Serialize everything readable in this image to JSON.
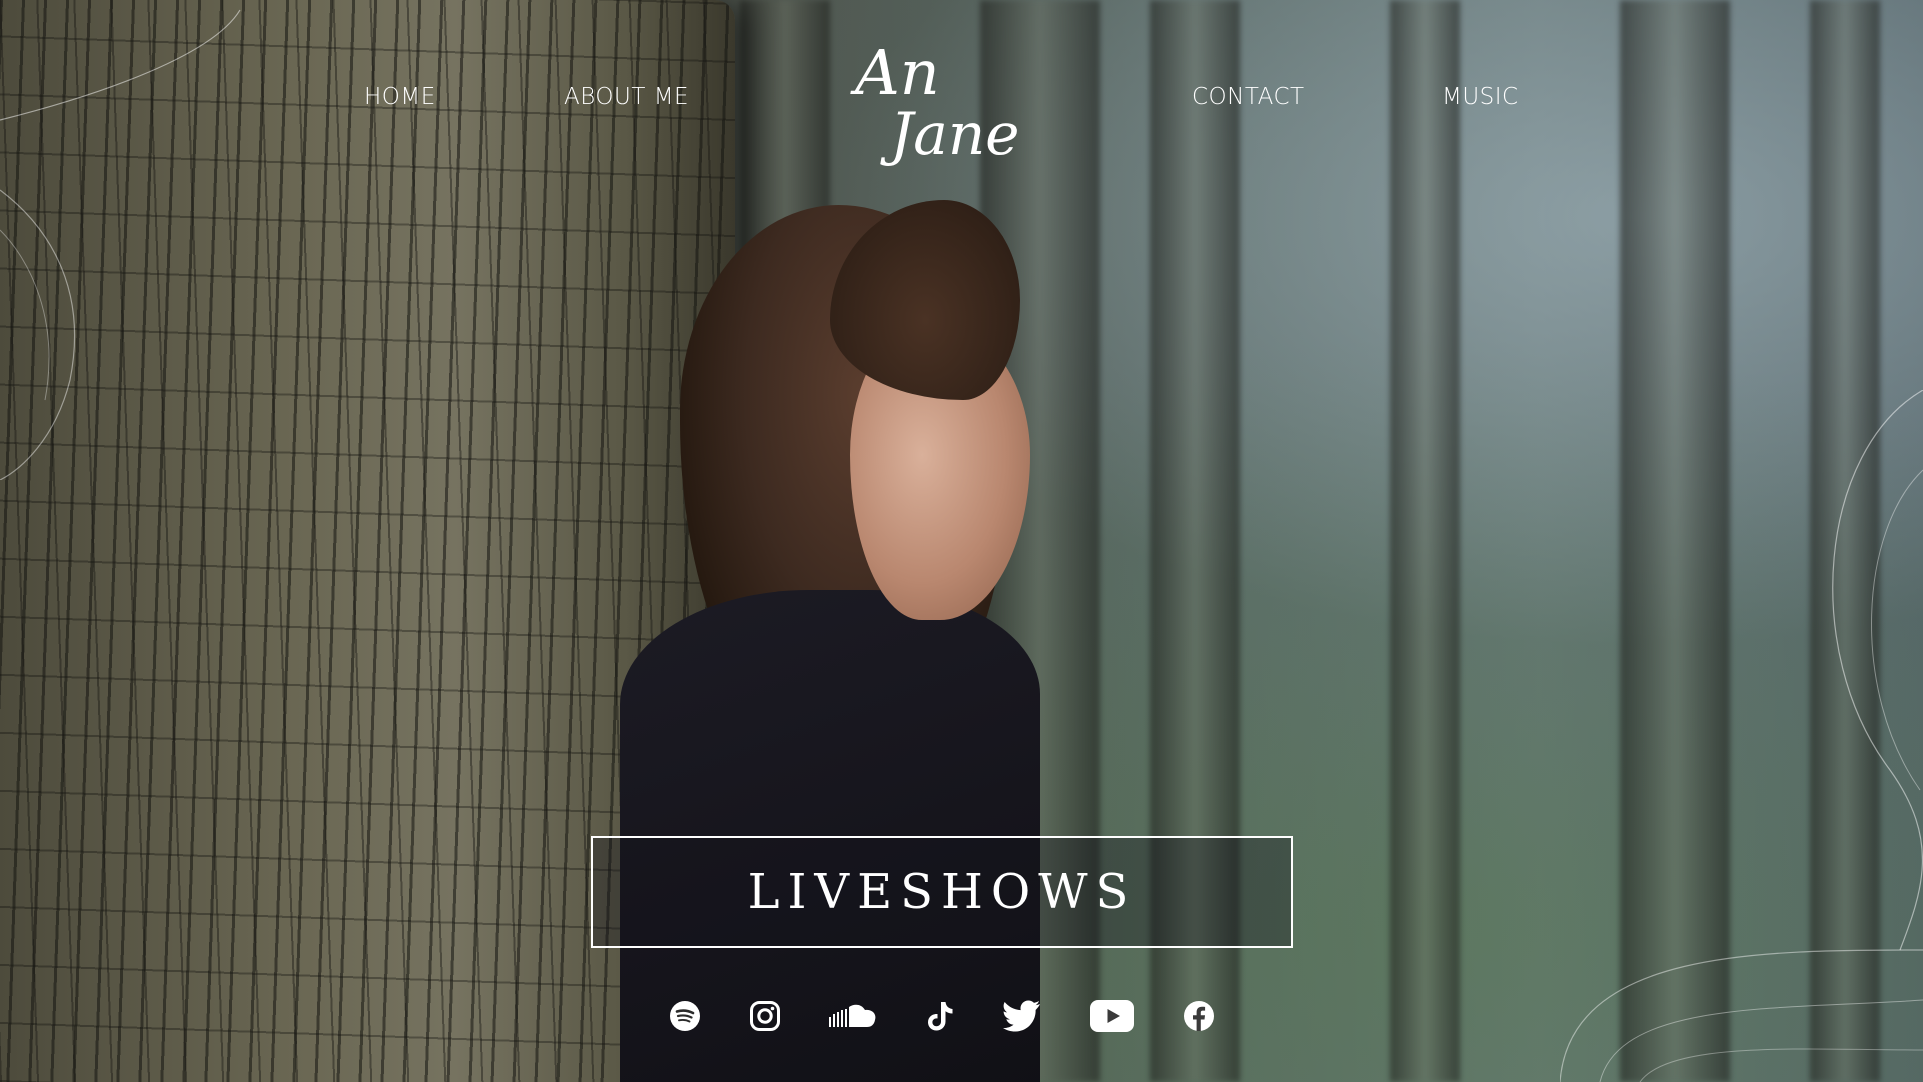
{
  "nav": {
    "home": "HOME",
    "about": "ABOUT ME",
    "contact": "CONTACT",
    "music": "MUSIC"
  },
  "logo": {
    "line1": "An",
    "line2": "Jane"
  },
  "cta": {
    "label": "LIVESHOWS"
  },
  "socials": [
    {
      "name": "spotify-icon"
    },
    {
      "name": "instagram-icon"
    },
    {
      "name": "soundcloud-icon"
    },
    {
      "name": "tiktok-icon"
    },
    {
      "name": "twitter-icon"
    },
    {
      "name": "youtube-icon"
    },
    {
      "name": "facebook-icon"
    }
  ],
  "colors": {
    "text": "#ffffff",
    "cta_border": "#ffffff"
  }
}
